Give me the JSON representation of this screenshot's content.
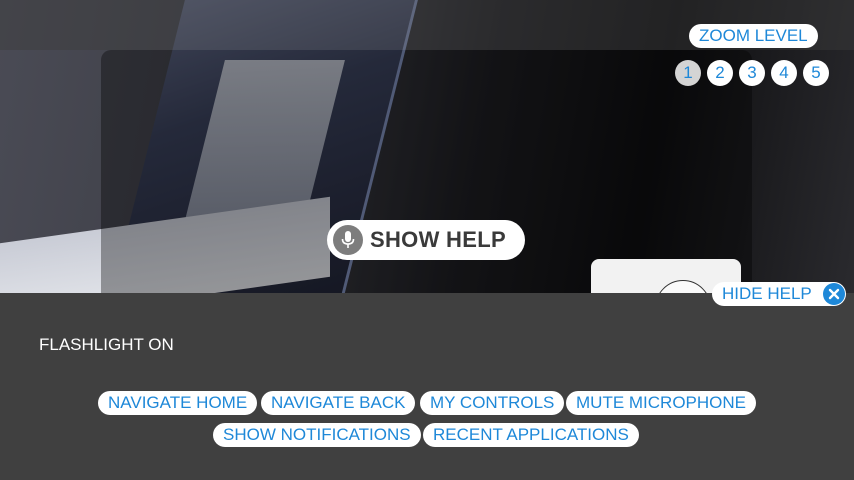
{
  "zoom": {
    "label": "ZOOM LEVEL",
    "levels": [
      "1",
      "2",
      "3",
      "4",
      "5"
    ],
    "active_level": "1"
  },
  "help": {
    "show_label": "SHOW HELP",
    "hide_label": "HIDE HELP"
  },
  "status": {
    "flashlight": "FLASHLIGHT ON"
  },
  "commands": {
    "row1": [
      "NAVIGATE HOME",
      "NAVIGATE BACK",
      "MY CONTROLS",
      "MUTE MICROPHONE"
    ],
    "row2": [
      "SHOW NOTIFICATIONS",
      "RECENT APPLICATIONS"
    ]
  },
  "colors": {
    "accent": "#1e88d8",
    "panel": "#404040",
    "pill_background": "#ffffff"
  },
  "icons": {
    "microphone": "microphone-icon",
    "close": "close-icon"
  }
}
